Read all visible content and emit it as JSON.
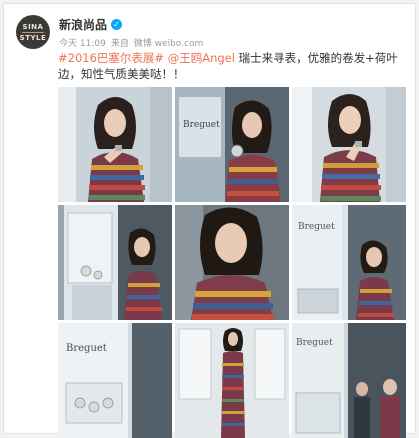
{
  "account": {
    "name": "新浪尚品",
    "avatar_lines": [
      "SINA",
      "STYLE"
    ]
  },
  "meta": {
    "time": "今天 11:09",
    "source_prefix": "来自",
    "source": "微博 weibo.com"
  },
  "post": {
    "hashtag": "#2016巴塞尔表展#",
    "mention": "@王鸥Angel",
    "text": " 瑞士来寻表，优雅的卷发+荷叶边，知性气质美美哒！！"
  },
  "photos": [
    {
      "scene": "woman-watch-portrait"
    },
    {
      "scene": "woman-watch-showcase"
    },
    {
      "scene": "woman-watch-portrait"
    },
    {
      "scene": "booth-display-case"
    },
    {
      "scene": "woman-closeup"
    },
    {
      "scene": "booth-woman-sideways"
    },
    {
      "scene": "booth-logo-wall"
    },
    {
      "scene": "woman-full-length"
    },
    {
      "scene": "booth-crowd"
    }
  ],
  "colors": {
    "link": "#eb7350",
    "verified": "#0ea3ff"
  }
}
